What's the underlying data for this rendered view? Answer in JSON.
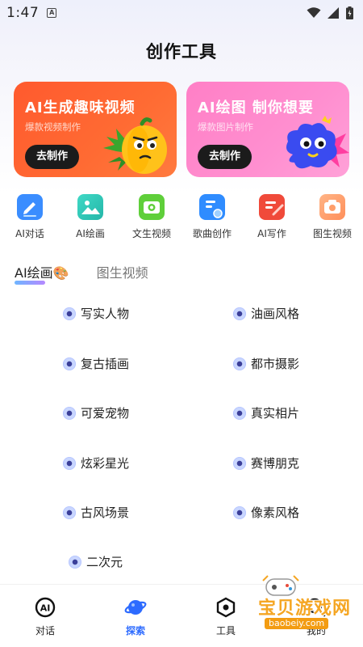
{
  "status_bar": {
    "time": "1:47",
    "badge": "A"
  },
  "page": {
    "title": "创作工具"
  },
  "cards": [
    {
      "title": "AI生成趣味视频",
      "subtitle": "爆款视频制作",
      "button": "去制作",
      "color": "#ff5a2e"
    },
    {
      "title": "AI绘图 制你想要",
      "subtitle": "爆款图片制作",
      "button": "去制作",
      "color": "#ff7fc6"
    }
  ],
  "tools": [
    {
      "label": "AI对话",
      "icon": "pen-chat-icon",
      "color": "#3a8dff"
    },
    {
      "label": "AI绘画",
      "icon": "picture-icon",
      "color": "#2fc7b5"
    },
    {
      "label": "文生视频",
      "icon": "camera-icon",
      "color": "#5fcf3a"
    },
    {
      "label": "歌曲创作",
      "icon": "music-doc-icon",
      "color": "#2f8cff"
    },
    {
      "label": "AI写作",
      "icon": "writing-icon",
      "color": "#f04a3a"
    },
    {
      "label": "图生视频",
      "icon": "photo-camera-icon",
      "color": "#ff9e6a"
    }
  ],
  "tabs": [
    {
      "label": "AI绘画🎨",
      "active": true
    },
    {
      "label": "图生视频",
      "active": false
    }
  ],
  "styles": [
    "写实人物",
    "油画风格",
    "复古插画",
    "都市摄影",
    "可爱宠物",
    "真实相片",
    "炫彩星光",
    "赛博朋克",
    "古风场景",
    "像素风格",
    "二次元"
  ],
  "nav": [
    {
      "label": "对话",
      "icon": "ai-chat-icon",
      "active": false
    },
    {
      "label": "探索",
      "icon": "planet-icon",
      "active": true
    },
    {
      "label": "工具",
      "icon": "hexagon-tool-icon",
      "active": false
    },
    {
      "label": "我的",
      "icon": "search-person-icon",
      "active": false
    }
  ],
  "watermark": {
    "text": "宝贝游戏网",
    "url": "baobeiy.com"
  },
  "colors": {
    "accent": "#2d6bff",
    "text": "#222222"
  }
}
